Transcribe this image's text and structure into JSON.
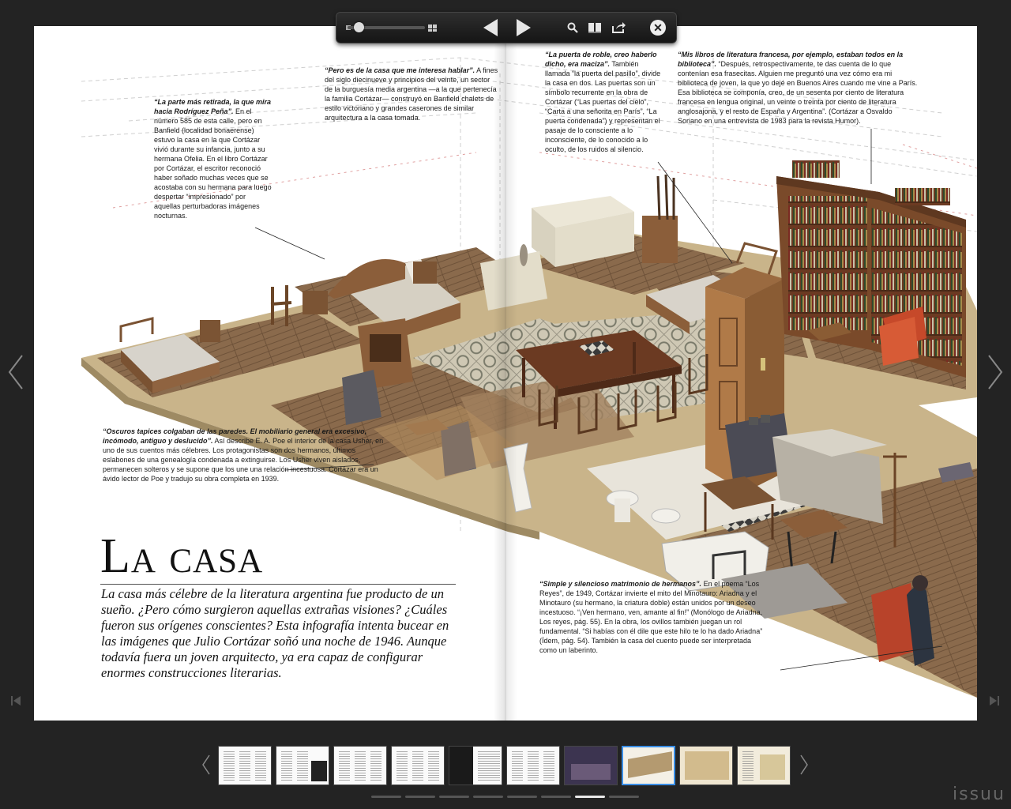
{
  "toolbar": {
    "zoom_level": 0.1,
    "icons": [
      "zoom-slider",
      "two-page-icon",
      "prev-page-icon",
      "next-page-icon",
      "search-icon",
      "pages-icon",
      "share-icon",
      "close-icon"
    ]
  },
  "page": {
    "title": "La casa",
    "intro": "La casa más célebre de la literatura argentina fue producto de un sueño. ¿Pero cómo surgieron aquellas extrañas visiones? ¿Cuáles fueron sus orígenes conscientes? Esta infografía intenta bucear en las imágenes que Julio Cortázar soñó una noche de 1946. Aunque todavía fuera un joven arquitecto, ya era capaz de configurar enormes construcciones literarias.",
    "captions": {
      "rodriguez": {
        "head": "“La parte más retirada, la que mira hacia Rodríguez Peña”.",
        "body": "En el número 585 de esta calle, pero en Banfield (localidad bonaerense) estuvo la casa en la que Cortázar vivió durante su infancia, junto a su hermana Ofelia. En el libro Cortázar por Cortázar, el escritor reconoció haber soñado muchas veces que se acostaba con su hermana para luego despertar “impresionado” por aquellas perturbadoras imágenes nocturnas."
      },
      "hablar": {
        "head": "“Pero es de la casa que me interesa hablar”.",
        "body": "A fines del siglo diecinueve y principios del veinte, un sector de la burguesía media argentina —a la que pertenecía la familia Cortázar— construyó en Banfield chalets de estilo victoriano y grandes caserones de similar arquitectura a la casa tomada."
      },
      "roble": {
        "head": "“La puerta de roble, creo haberlo dicho, era maciza”.",
        "body": "También llamada “la puerta del pasillo”, divide la casa en dos. Las puertas son un símbolo recurrente en la obra de Cortázar (“Las puertas del cielo”, “Carta a una señorita en París”, “La puerta condenada”) y representan el pasaje de lo consciente a lo inconsciente, de lo conocido a lo oculto, de los ruidos al silencio."
      },
      "libros": {
        "head": "“Mis libros de literatura francesa, por ejemplo, estaban todos en la biblioteca”.",
        "body": "“Después, retrospectivamente, te das cuenta de lo que contenían esa frasecitas. Alguien me preguntó una vez cómo era mi biblioteca de joven, la que yo dejé en Buenos Aires cuando me vine a París. Esa biblioteca se componía, creo, de un sesenta por ciento de literatura francesa en lengua original, un veinte o treinta por ciento de literatura anglosajona, y el resto de España y Argentina”. (Cortázar a Osvaldo Soriano en una entrevista de 1983 para la revista Humor)."
      },
      "tapices": {
        "head": "“Oscuros tapices colgaban de las paredes. El mobiliario general era excesivo, incómodo, antiguo y deslucido”.",
        "body": "Así describe E. A. Poe el interior de la casa Usher, en uno de sus cuentos más célebres. Los protagonistas son dos hermanos, últimos eslabones de una genealogía condenada a extinguirse. Los Usher viven aislados, permanecen solteros y se supone que los une una relación incestuosa. Cortázar era un ávido lector de Poe y tradujo su obra completa en 1939."
      },
      "matrimonio": {
        "head": "“Simple y silencioso matrimonio de hermanos”.",
        "body": "En el poema “Los Reyes”, de 1949, Cortázar invierte el mito del Minotauro: Ariadna y el Minotauro (su hermano, la criatura doble) están unidos por un deseo incestuoso. “¡Ven hermano, ven, amante al fin!” (Monólogo de Ariadna, Los reyes, pág. 55). En la obra, los ovillos también juegan un rol fundamental. “Si habías con él dile que este hilo te lo ha dado Ariadna” (Ídem, pág. 54). También la casa del cuento puede ser interpretada como un laberinto."
      }
    }
  },
  "nav": {
    "thumb_count": 10,
    "active_thumb": 7,
    "pager_count": 8,
    "active_pager": 6
  },
  "brand": "issuu"
}
